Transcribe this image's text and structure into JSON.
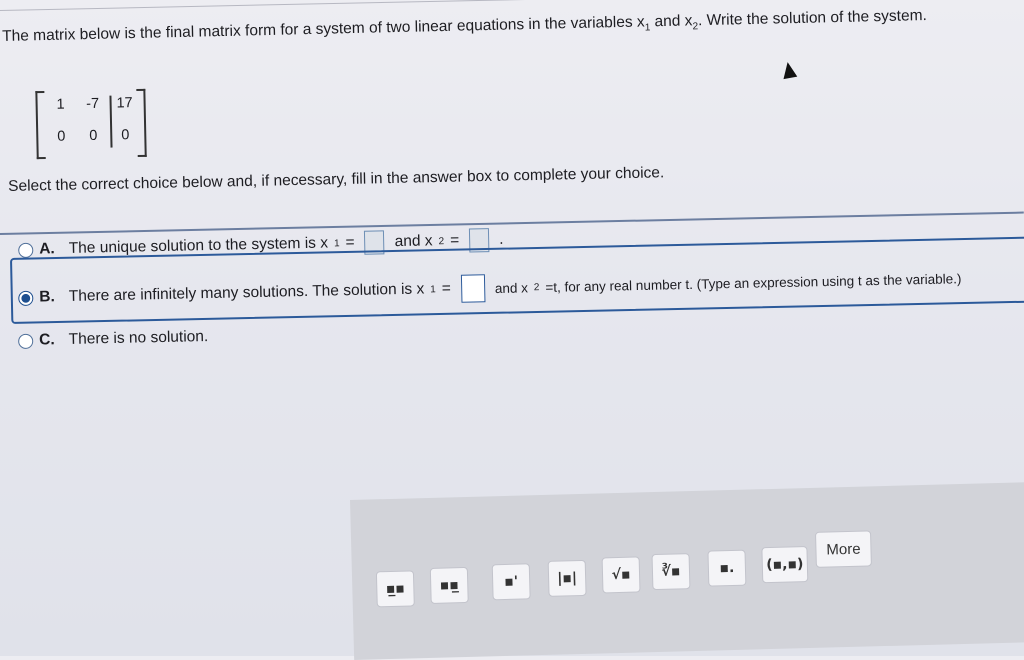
{
  "question": {
    "line_a": "The matrix below is the final matrix form for a system of two linear equations in the variables x",
    "sub1": "1",
    "line_b": " and x",
    "sub2": "2",
    "line_c": ". Write the solution of the system."
  },
  "matrix": {
    "r1": [
      "1",
      "-7",
      "17"
    ],
    "r2": [
      "0",
      "0",
      "0"
    ]
  },
  "instruction": "Select the correct choice below and, if necessary, fill in the answer box to complete your choice.",
  "options": {
    "a": {
      "letter": "A.",
      "text1": "The unique solution to the system is x",
      "sub1": "1",
      "eq": " =",
      "and": "and x",
      "sub2": "2",
      "eq2": " =",
      "end": "."
    },
    "b": {
      "letter": "B.",
      "text1": "There are infinitely many solutions. The solution is x",
      "sub1": "1",
      "eq": " =",
      "and": "and x",
      "sub2": "2",
      "rest": " =t, for any real number t. (Type an expression using t as the variable.)",
      "selected": true
    },
    "c": {
      "letter": "C.",
      "text": "There is no solution."
    }
  },
  "toolbar": {
    "icons": [
      "fraction-icon",
      "mixed-number-icon",
      "exponent-icon",
      "absolute-value-icon",
      "sqrt-icon",
      "nth-root-icon",
      "decimal-icon",
      "ordered-pair-icon"
    ],
    "glyphs": [
      "▪̲▪",
      "▪▪̲",
      "▪'",
      "|▪|",
      "√▪",
      "∛▪",
      "▪.",
      "(▪,▪)"
    ],
    "more_label": "More"
  }
}
